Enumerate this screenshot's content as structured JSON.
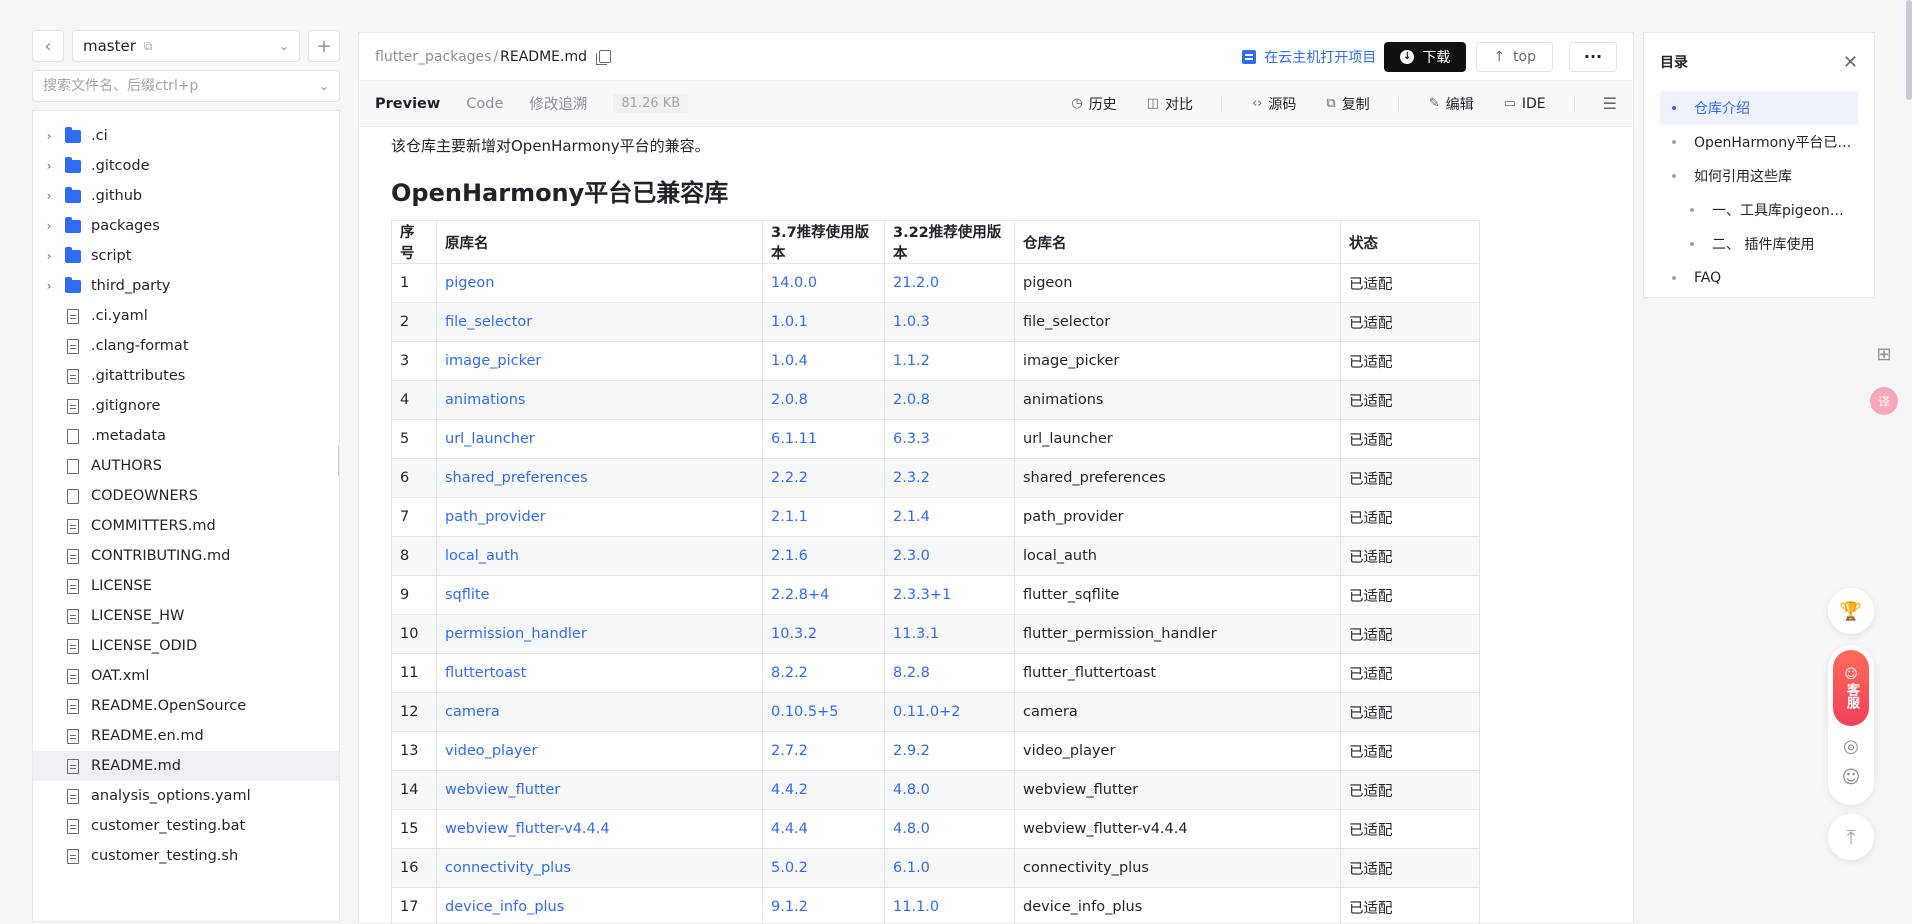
{
  "branch": {
    "name": "master"
  },
  "search": {
    "placeholder": "搜索文件名、后缀ctrl+p"
  },
  "tree": [
    {
      "name": ".ci",
      "type": "folder"
    },
    {
      "name": ".gitcode",
      "type": "folder"
    },
    {
      "name": ".github",
      "type": "folder"
    },
    {
      "name": "packages",
      "type": "folder"
    },
    {
      "name": "script",
      "type": "folder"
    },
    {
      "name": "third_party",
      "type": "folder"
    },
    {
      "name": ".ci.yaml",
      "type": "file"
    },
    {
      "name": ".clang-format",
      "type": "file"
    },
    {
      "name": ".gitattributes",
      "type": "file"
    },
    {
      "name": ".gitignore",
      "type": "file"
    },
    {
      "name": ".metadata",
      "type": "file"
    },
    {
      "name": "AUTHORS",
      "type": "file"
    },
    {
      "name": "CODEOWNERS",
      "type": "file"
    },
    {
      "name": "COMMITTERS.md",
      "type": "file"
    },
    {
      "name": "CONTRIBUTING.md",
      "type": "file"
    },
    {
      "name": "LICENSE",
      "type": "file"
    },
    {
      "name": "LICENSE_HW",
      "type": "file"
    },
    {
      "name": "LICENSE_ODID",
      "type": "file"
    },
    {
      "name": "OAT.xml",
      "type": "file"
    },
    {
      "name": "README.OpenSource",
      "type": "file"
    },
    {
      "name": "README.en.md",
      "type": "file"
    },
    {
      "name": "README.md",
      "type": "file",
      "selected": true
    },
    {
      "name": "analysis_options.yaml",
      "type": "file"
    },
    {
      "name": "customer_testing.bat",
      "type": "file"
    },
    {
      "name": "customer_testing.sh",
      "type": "file"
    }
  ],
  "path": {
    "repo": "flutter_packages",
    "sep": "/",
    "file": "README.md"
  },
  "actions": {
    "cloud": "在云主机打开项目",
    "download": "下载",
    "top": "top",
    "more": "···"
  },
  "tabs": {
    "preview": "Preview",
    "code": "Code",
    "history_track": "修改追溯",
    "size": "81.26 KB"
  },
  "tools": {
    "history": "历史",
    "compare": "对比",
    "source": "源码",
    "copy": "复制",
    "edit": "编辑",
    "ide": "IDE"
  },
  "doc": {
    "intro": "该仓库主要新增对OpenHarmony平台的兼容。",
    "heading": "OpenHarmony平台已兼容库",
    "headers": [
      "序号",
      "原库名",
      "3.7推荐使用版本",
      "3.22推荐使用版本",
      "仓库名",
      "状态"
    ],
    "rows": [
      [
        "1",
        "pigeon",
        "14.0.0",
        "21.2.0",
        "pigeon",
        "已适配"
      ],
      [
        "2",
        "file_selector",
        "1.0.1",
        "1.0.3",
        "file_selector",
        "已适配"
      ],
      [
        "3",
        "image_picker",
        "1.0.4",
        "1.1.2",
        "image_picker",
        "已适配"
      ],
      [
        "4",
        "animations",
        "2.0.8",
        "2.0.8",
        "animations",
        "已适配"
      ],
      [
        "5",
        "url_launcher",
        "6.1.11",
        "6.3.3",
        "url_launcher",
        "已适配"
      ],
      [
        "6",
        "shared_preferences",
        "2.2.2",
        "2.3.2",
        "shared_preferences",
        "已适配"
      ],
      [
        "7",
        "path_provider",
        "2.1.1",
        "2.1.4",
        "path_provider",
        "已适配"
      ],
      [
        "8",
        "local_auth",
        "2.1.6",
        "2.3.0",
        "local_auth",
        "已适配"
      ],
      [
        "9",
        "sqflite",
        "2.2.8+4",
        "2.3.3+1",
        "flutter_sqflite",
        "已适配"
      ],
      [
        "10",
        "permission_handler",
        "10.3.2",
        "11.3.1",
        "flutter_permission_handler",
        "已适配"
      ],
      [
        "11",
        "fluttertoast",
        "8.2.2",
        "8.2.8",
        "flutter_fluttertoast",
        "已适配"
      ],
      [
        "12",
        "camera",
        "0.10.5+5",
        "0.11.0+2",
        "camera",
        "已适配"
      ],
      [
        "13",
        "video_player",
        "2.7.2",
        "2.9.2",
        "video_player",
        "已适配"
      ],
      [
        "14",
        "webview_flutter",
        "4.4.2",
        "4.8.0",
        "webview_flutter",
        "已适配"
      ],
      [
        "15",
        "webview_flutter-v4.4.4",
        "4.4.4",
        "4.8.0",
        "webview_flutter-v4.4.4",
        "已适配"
      ],
      [
        "16",
        "connectivity_plus",
        "5.0.2",
        "6.1.0",
        "connectivity_plus",
        "已适配"
      ],
      [
        "17",
        "device_info_plus",
        "9.1.2",
        "11.1.0",
        "device_info_plus",
        "已适配"
      ]
    ]
  },
  "toc": {
    "title": "目录",
    "items": [
      {
        "label": "仓库介绍",
        "level": 1,
        "active": true
      },
      {
        "label": "OpenHarmony平台已…",
        "level": 1
      },
      {
        "label": "如何引用这些库",
        "level": 1
      },
      {
        "label": "一、工具库pigeon…",
        "level": 2
      },
      {
        "label": "二、 插件库使用",
        "level": 2
      },
      {
        "label": "FAQ",
        "level": 1
      }
    ]
  },
  "float": {
    "kefu": "客服"
  },
  "colors": {
    "accent": "#2f6bf5",
    "download_bg": "#111111",
    "kefu_gradient": "#f0415a"
  }
}
